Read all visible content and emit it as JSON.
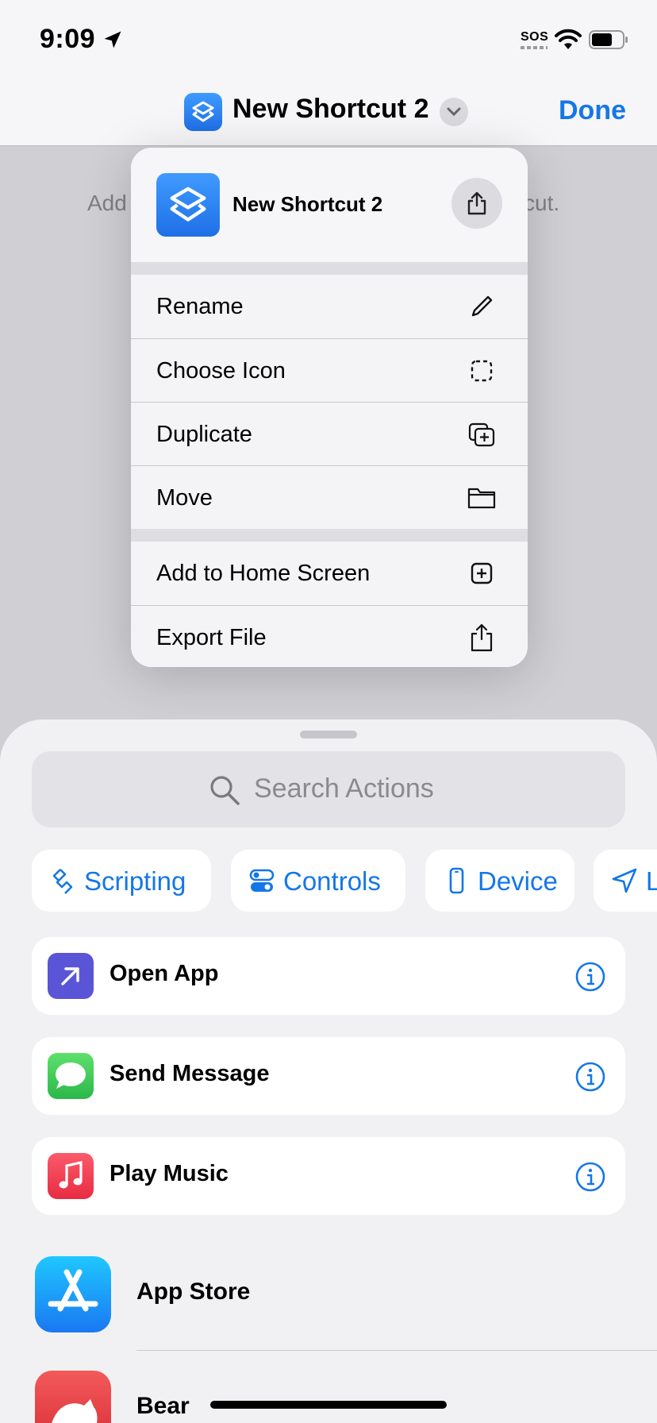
{
  "status_bar": {
    "time": "9:09",
    "sos": "SOS"
  },
  "nav": {
    "title": "New Shortcut 2",
    "done_label": "Done"
  },
  "editor": {
    "hint_left": "Add",
    "hint_right": "cut."
  },
  "menu": {
    "header_title": "New Shortcut 2",
    "group1": [
      {
        "label": "Rename",
        "icon": "pencil-icon"
      },
      {
        "label": "Choose Icon",
        "icon": "dashed-square-icon"
      },
      {
        "label": "Duplicate",
        "icon": "duplicate-icon"
      },
      {
        "label": "Move",
        "icon": "folder-icon"
      }
    ],
    "group2": [
      {
        "label": "Add to Home Screen",
        "icon": "plus-square-icon"
      },
      {
        "label": "Export File",
        "icon": "export-icon"
      }
    ]
  },
  "sheet": {
    "search_placeholder": "Search Actions",
    "chips": [
      "Scripting",
      "Controls",
      "Device",
      "L"
    ],
    "actions": [
      {
        "label": "Open App",
        "color": "#5a55d6"
      },
      {
        "label": "Send Message",
        "color": "#34c759"
      },
      {
        "label": "Play Music",
        "color": "#f2404f"
      }
    ],
    "apps": [
      "App Store",
      "Bear"
    ]
  },
  "colors": {
    "accent": "#1577e6",
    "shortcuts_icon": "#2a84f5"
  }
}
